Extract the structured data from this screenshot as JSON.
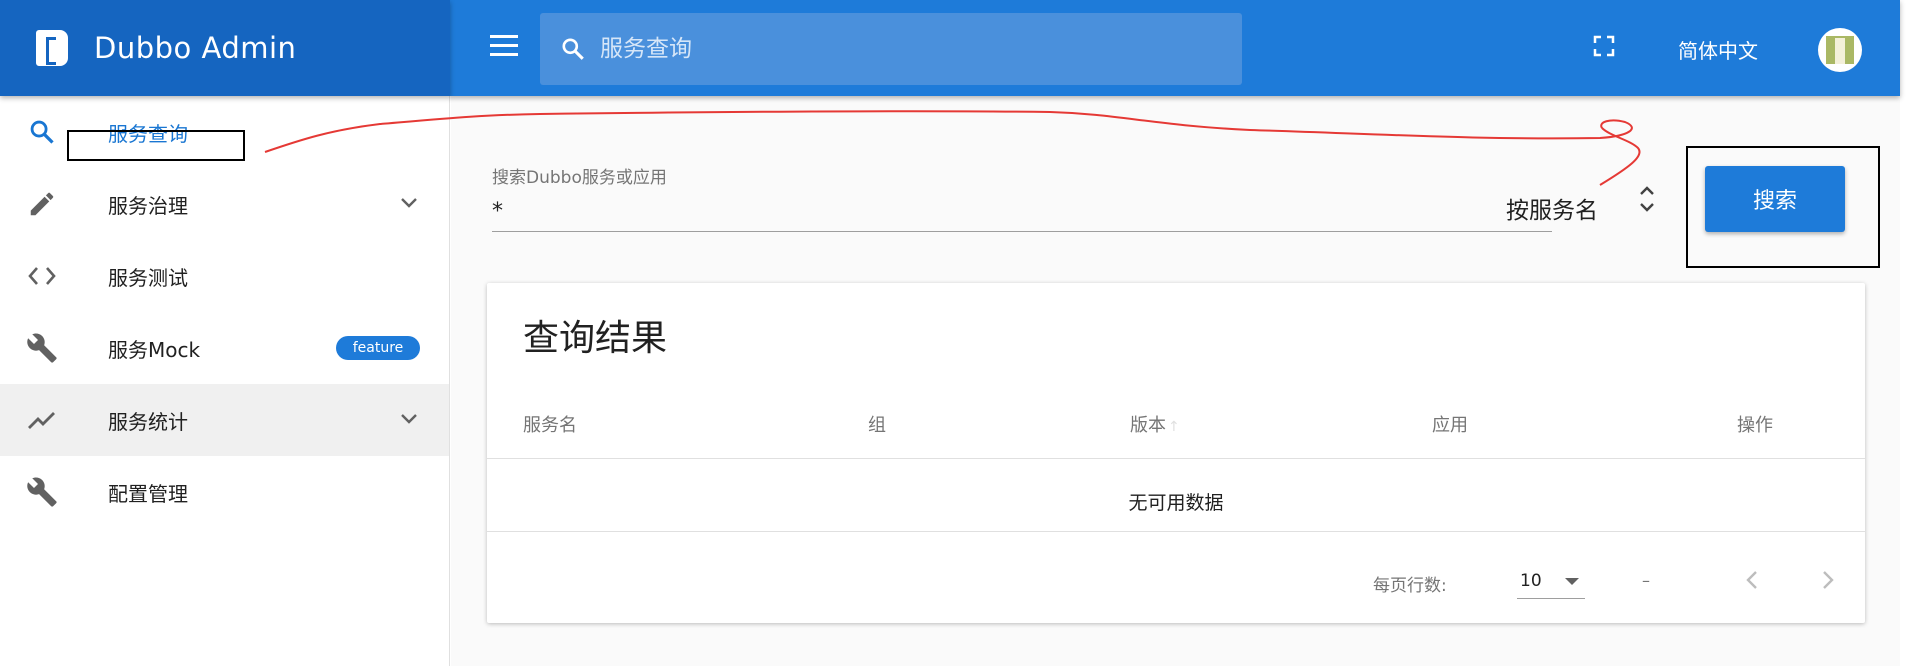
{
  "header": {
    "app_title": "Dubbo Admin",
    "search_placeholder": "服务查询",
    "language": "简体中文"
  },
  "sidebar": {
    "items": [
      {
        "label": "服务查询",
        "icon": "search-icon"
      },
      {
        "label": "服务治理",
        "icon": "pencil-icon",
        "expandable": true
      },
      {
        "label": "服务测试",
        "icon": "code-icon"
      },
      {
        "label": "服务Mock",
        "icon": "wrench-icon",
        "badge": "feature"
      },
      {
        "label": "服务统计",
        "icon": "trending-up-icon",
        "expandable": true
      },
      {
        "label": "配置管理",
        "icon": "wrench-icon"
      }
    ]
  },
  "search_form": {
    "field_label": "搜索Dubbo服务或应用",
    "field_value": "*",
    "search_type": "按服务名",
    "button_label": "搜索"
  },
  "results": {
    "title": "查询结果",
    "columns": [
      "服务名",
      "组",
      "版本",
      "应用",
      "操作"
    ],
    "sort_indicator": "↑",
    "empty_text": "无可用数据",
    "rows_per_page_label": "每页行数:",
    "rows_per_page": "10",
    "page_range": "–"
  },
  "colors": {
    "brand": "#1565c0",
    "topbar": "#1e7bd9",
    "accent": "#1976d2",
    "annotation": "#e53935"
  }
}
